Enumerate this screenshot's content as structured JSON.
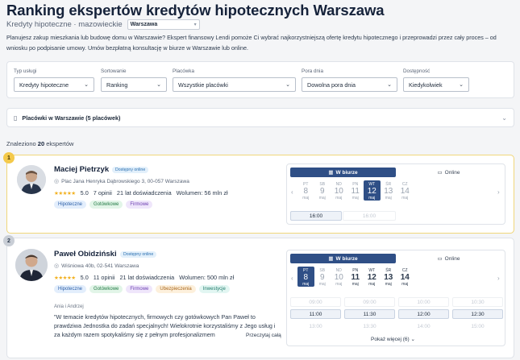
{
  "header": {
    "title": "Ranking ekspertów kredytów hipotecznych Warszawa",
    "subtitle": "Kredyty hipoteczne · mazowieckie",
    "city": "Warszawa",
    "intro": "Planujesz zakup mieszkania lub budowę domu w Warszawie? Ekspert finansowy Lendi pomoże Ci wybrać najkorzystniejszą ofertę kredytu hipotecznego i przeprowadzi przez cały proces – od wniosku po podpisanie umowy. Umów bezpłatną konsultację w biurze w Warszawie lub online."
  },
  "filters": [
    {
      "label": "Typ usługi",
      "value": "Kredyty hipoteczne"
    },
    {
      "label": "Sortowanie",
      "value": "Ranking"
    },
    {
      "label": "Placówka",
      "value": "Wszystkie placówki"
    },
    {
      "label": "Pora dnia",
      "value": "Dowolna pora dnia"
    },
    {
      "label": "Dostępność",
      "value": "Kiedykolwiek"
    }
  ],
  "branches": {
    "label": "Placówki w Warszawie (5 placówek)"
  },
  "results": {
    "prefix": "Znaleziono",
    "count": "20",
    "suffix": "ekspertów"
  },
  "experts": [
    {
      "rank": "1",
      "name": "Maciej Pietrzyk",
      "badge": "Dostępny online",
      "address": "Plac Jana Henryka Dąbrowskiego 3, 00-057 Warszawa",
      "stars": "★★★★★",
      "rating": "5.0",
      "reviews": "7 opinii",
      "experience": "21 lat doświadczenia",
      "volume": "Wolumen: 56 mln zł",
      "tags": [
        "Hipoteczne",
        "Gotówkowe",
        "Firmowe"
      ],
      "modes": {
        "office": "W biurze",
        "online": "Online"
      },
      "days": [
        {
          "name": "PT",
          "date": "8",
          "month": "maj"
        },
        {
          "name": "SB",
          "date": "9",
          "month": "maj"
        },
        {
          "name": "ND",
          "date": "10",
          "month": "maj"
        },
        {
          "name": "PN",
          "date": "11",
          "month": "maj"
        },
        {
          "name": "WT",
          "date": "12",
          "month": "maj"
        },
        {
          "name": "ŚR",
          "date": "13",
          "month": "maj"
        },
        {
          "name": "CZ",
          "date": "14",
          "month": "maj"
        }
      ],
      "slots": [
        "16:00",
        "16:00"
      ]
    },
    {
      "rank": "2",
      "name": "Paweł Obidziński",
      "badge": "Dostępny online",
      "address": "Wiśniowa 40b, 02-541 Warszawa",
      "stars": "★★★★★",
      "rating": "5.0",
      "reviews": "11 opinii",
      "experience": "21 lat doświadczenia",
      "volume": "Wolumen: 500 mln zł",
      "tags": [
        "Hipoteczne",
        "Gotówkowe",
        "Firmowe",
        "Ubezpieczenia",
        "Inwestycje"
      ],
      "review_author": "Ania i Andrzej",
      "review_text": "\"W temacie kredytów hipotecznych, firmowych czy gotówkowych Pan Paweł to prawdziwa Jednostka do zadań specjalnych! Wielokrotnie korzystaliśmy z Jego usług i za każdym razem spotykaliśmy się z pełnym profesjonalizmem",
      "read_more": "Przeczytaj całą",
      "modes": {
        "office": "W biurze",
        "online": "Online"
      },
      "days": [
        {
          "name": "PT",
          "date": "8",
          "month": "maj"
        },
        {
          "name": "SB",
          "date": "9",
          "month": "maj"
        },
        {
          "name": "ND",
          "date": "10",
          "month": "maj"
        },
        {
          "name": "PN",
          "date": "11",
          "month": "maj"
        },
        {
          "name": "WT",
          "date": "12",
          "month": "maj"
        },
        {
          "name": "ŚR",
          "date": "13",
          "month": "maj"
        },
        {
          "name": "CZ",
          "date": "14",
          "month": "maj"
        }
      ],
      "slots": [
        "09:00",
        "09:00",
        "10:00",
        "10:30",
        "11:00",
        "11:30",
        "12:00",
        "12:30",
        "13:00",
        "13:30",
        "14:00",
        "15:00"
      ],
      "show_more": "Pokaż więcej (6)"
    }
  ],
  "colors": {
    "accent": "#2f4f86",
    "gold": "#f4c94a",
    "star": "#f2b01e"
  }
}
